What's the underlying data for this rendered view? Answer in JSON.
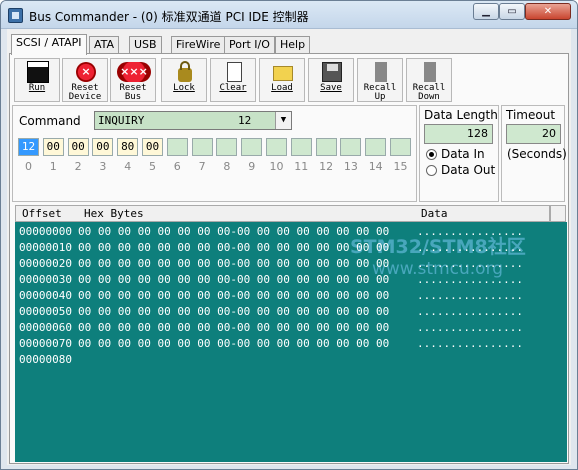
{
  "window": {
    "title": "Bus Commander - (0) 标准双通道 PCI IDE 控制器",
    "min_label": "▁",
    "max_label": "▭",
    "close_label": "✕"
  },
  "tabs": [
    "SCSI / ATAPI",
    "ATA",
    "USB",
    "FireWire",
    "Port I/O",
    "Help"
  ],
  "toolbar": {
    "run": "Run",
    "reset_device": [
      "Reset",
      "Device"
    ],
    "reset_bus": [
      "Reset",
      "Bus"
    ],
    "lock": "Lock",
    "clear": "Clear",
    "load": "Load",
    "save": "Save",
    "recall_up": [
      "Recall",
      "Up"
    ],
    "recall_down": [
      "Recall",
      "Down"
    ]
  },
  "command": {
    "label": "Command",
    "name": "INQUIRY",
    "code": "12"
  },
  "cdb": {
    "bytes": [
      "12",
      "00",
      "00",
      "00",
      "80",
      "00",
      "",
      "",
      "",
      "",
      "",
      "",
      "",
      "",
      "",
      ""
    ],
    "indices": [
      "0",
      "1",
      "2",
      "3",
      "4",
      "5",
      "6",
      "7",
      "8",
      "9",
      "10",
      "11",
      "12",
      "13",
      "14",
      "15"
    ]
  },
  "data_length": {
    "label": "Data Length",
    "value": "128",
    "data_in": "Data In",
    "data_out": "Data Out",
    "direction": "in"
  },
  "timeout": {
    "label": "Timeout",
    "value": "20",
    "unit": "(Seconds)"
  },
  "hex": {
    "col_offset": "Offset",
    "col_hex": "Hex Bytes",
    "col_data": "Data",
    "rows": [
      {
        "offset": "00000000",
        "bytes": "00 00 00 00 00 00 00 00-00 00 00 00 00 00 00 00",
        "data": "................"
      },
      {
        "offset": "00000010",
        "bytes": "00 00 00 00 00 00 00 00-00 00 00 00 00 00 00 00",
        "data": "................"
      },
      {
        "offset": "00000020",
        "bytes": "00 00 00 00 00 00 00 00-00 00 00 00 00 00 00 00",
        "data": "................"
      },
      {
        "offset": "00000030",
        "bytes": "00 00 00 00 00 00 00 00-00 00 00 00 00 00 00 00",
        "data": "................"
      },
      {
        "offset": "00000040",
        "bytes": "00 00 00 00 00 00 00 00-00 00 00 00 00 00 00 00",
        "data": "................"
      },
      {
        "offset": "00000050",
        "bytes": "00 00 00 00 00 00 00 00-00 00 00 00 00 00 00 00",
        "data": "................"
      },
      {
        "offset": "00000060",
        "bytes": "00 00 00 00 00 00 00 00-00 00 00 00 00 00 00 00",
        "data": "................"
      },
      {
        "offset": "00000070",
        "bytes": "00 00 00 00 00 00 00 00-00 00 00 00 00 00 00 00",
        "data": "................"
      },
      {
        "offset": "00000080",
        "bytes": "",
        "data": ""
      }
    ]
  },
  "watermark": {
    "line1": "STM32/STM8社区",
    "line2": "www.stmcu.org"
  },
  "colors": {
    "hex_bg": "#0e7f7c",
    "field_green": "#cfe8cf",
    "selected_byte": "#3399ff"
  }
}
